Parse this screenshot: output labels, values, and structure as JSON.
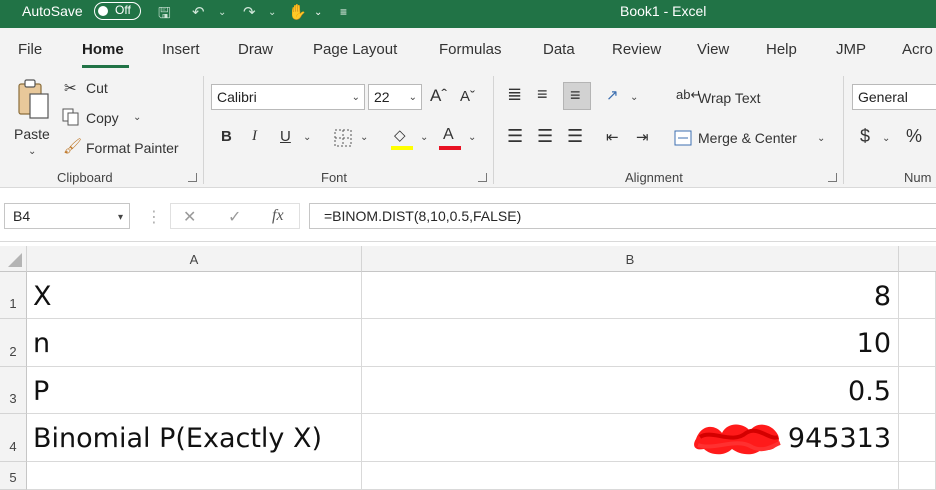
{
  "titlebar": {
    "autosave_label": "AutoSave",
    "autosave_state": "Off",
    "document_title": "Book1  -  Excel",
    "accent_color": "#217346"
  },
  "tabs": [
    {
      "label": "File"
    },
    {
      "label": "Home",
      "active": true
    },
    {
      "label": "Insert"
    },
    {
      "label": "Draw"
    },
    {
      "label": "Page Layout"
    },
    {
      "label": "Formulas"
    },
    {
      "label": "Data"
    },
    {
      "label": "Review"
    },
    {
      "label": "View"
    },
    {
      "label": "Help"
    },
    {
      "label": "JMP"
    },
    {
      "label": "Acro"
    }
  ],
  "ribbon": {
    "clipboard": {
      "paste": "Paste",
      "cut": "Cut",
      "copy": "Copy",
      "format_painter": "Format Painter",
      "group": "Clipboard"
    },
    "font": {
      "family": "Calibri",
      "size": "22",
      "group": "Font",
      "highlight_color": "#ffff00",
      "font_color": "#e81123"
    },
    "alignment": {
      "wrap_text": "Wrap Text",
      "merge_center": "Merge & Center",
      "group": "Alignment"
    },
    "number": {
      "format": "General",
      "currency": "$",
      "percent": "%",
      "group": "Num"
    }
  },
  "formula_bar": {
    "name_box": "B4",
    "formula": "=BINOM.DIST(8,10,0.5,FALSE)"
  },
  "grid": {
    "columns": [
      "A",
      "B"
    ],
    "rows": [
      {
        "num": "1",
        "a": "X",
        "b": "8"
      },
      {
        "num": "2",
        "a": "n",
        "b": "10"
      },
      {
        "num": "3",
        "a": "P",
        "b": "0.5"
      },
      {
        "num": "4",
        "a": "Binomial P(Exactly X)",
        "b": "945313",
        "b_redacted": true
      },
      {
        "num": "5",
        "a": "",
        "b": ""
      }
    ]
  }
}
